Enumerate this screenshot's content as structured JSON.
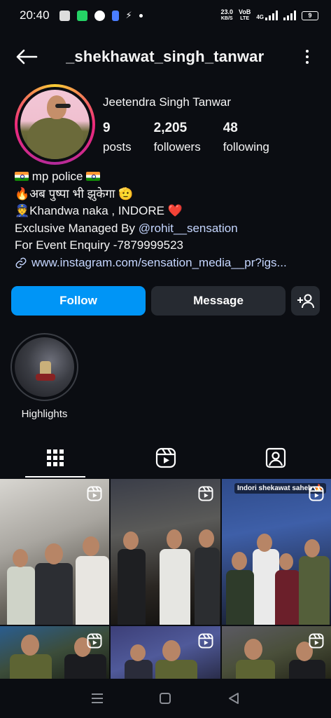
{
  "status_bar": {
    "time": "20:40",
    "network_speed_value": "23.0",
    "network_speed_unit": "KB/S",
    "volte_top": "VoB",
    "volte_bottom": "LTE",
    "network_type": "4G",
    "battery_level": "9"
  },
  "header": {
    "username": "_shekhawat_singh_tanwar"
  },
  "profile": {
    "display_name": "Jeetendra Singh Tanwar",
    "stats": [
      {
        "value": "9",
        "label": "posts"
      },
      {
        "value": "2,205",
        "label": "followers"
      },
      {
        "value": "48",
        "label": "following"
      }
    ]
  },
  "bio": {
    "line1": "mp police",
    "line2": "🔥अब पुष्पा भी झुकेगा 🫡",
    "line3_prefix": "👮",
    "line3": "Khandwa naka , INDORE",
    "line3_suffix": "❤️",
    "line4_prefix": "Exclusive Managed By ",
    "line4_mention": "@rohit__sensation",
    "line5": "For Event Enquiry -7879999523",
    "link": "www.instagram.com/sensation_media__pr?igs..."
  },
  "actions": {
    "follow_label": "Follow",
    "message_label": "Message"
  },
  "highlights": [
    {
      "label": "Highlights"
    }
  ],
  "grid": {
    "caption_3": "Indori shekawat saheb 🔥"
  },
  "colors": {
    "background": "#0b0d12",
    "follow_button": "#0095f6",
    "secondary_button": "#262a31",
    "link": "#c5d6ff"
  },
  "icons": {
    "back": "arrow-left-icon",
    "more": "vertical-dots-icon",
    "add_user": "add-user-icon",
    "grid_tab": "grid-icon",
    "reels_tab": "reels-icon",
    "tagged_tab": "tagged-icon",
    "reel_badge": "reel-icon",
    "link": "link-icon"
  }
}
